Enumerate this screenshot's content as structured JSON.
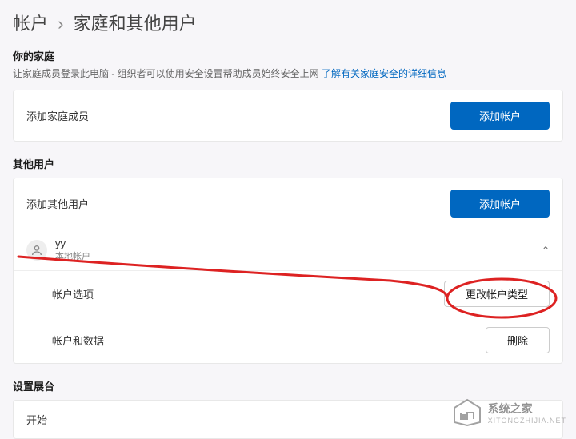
{
  "breadcrumb": {
    "parent": "帐户",
    "current": "家庭和其他用户"
  },
  "family": {
    "title": "你的家庭",
    "desc": "让家庭成员登录此电脑 - 组织者可以使用安全设置帮助成员始终安全上网",
    "link": "了解有关家庭安全的详细信息",
    "addLabel": "添加家庭成员",
    "addButton": "添加帐户"
  },
  "others": {
    "title": "其他用户",
    "addLabel": "添加其他用户",
    "addButton": "添加帐户",
    "user": {
      "name": "yy",
      "type": "本地帐户",
      "optionsLabel": "帐户选项",
      "changeTypeButton": "更改帐户类型",
      "dataLabel": "帐户和数据",
      "deleteButton": "删除"
    }
  },
  "kiosk": {
    "title": "设置展台",
    "startLabel": "开始"
  },
  "watermark": {
    "text": "系统之家",
    "sub": "XITONGZHIJIA.NET"
  }
}
